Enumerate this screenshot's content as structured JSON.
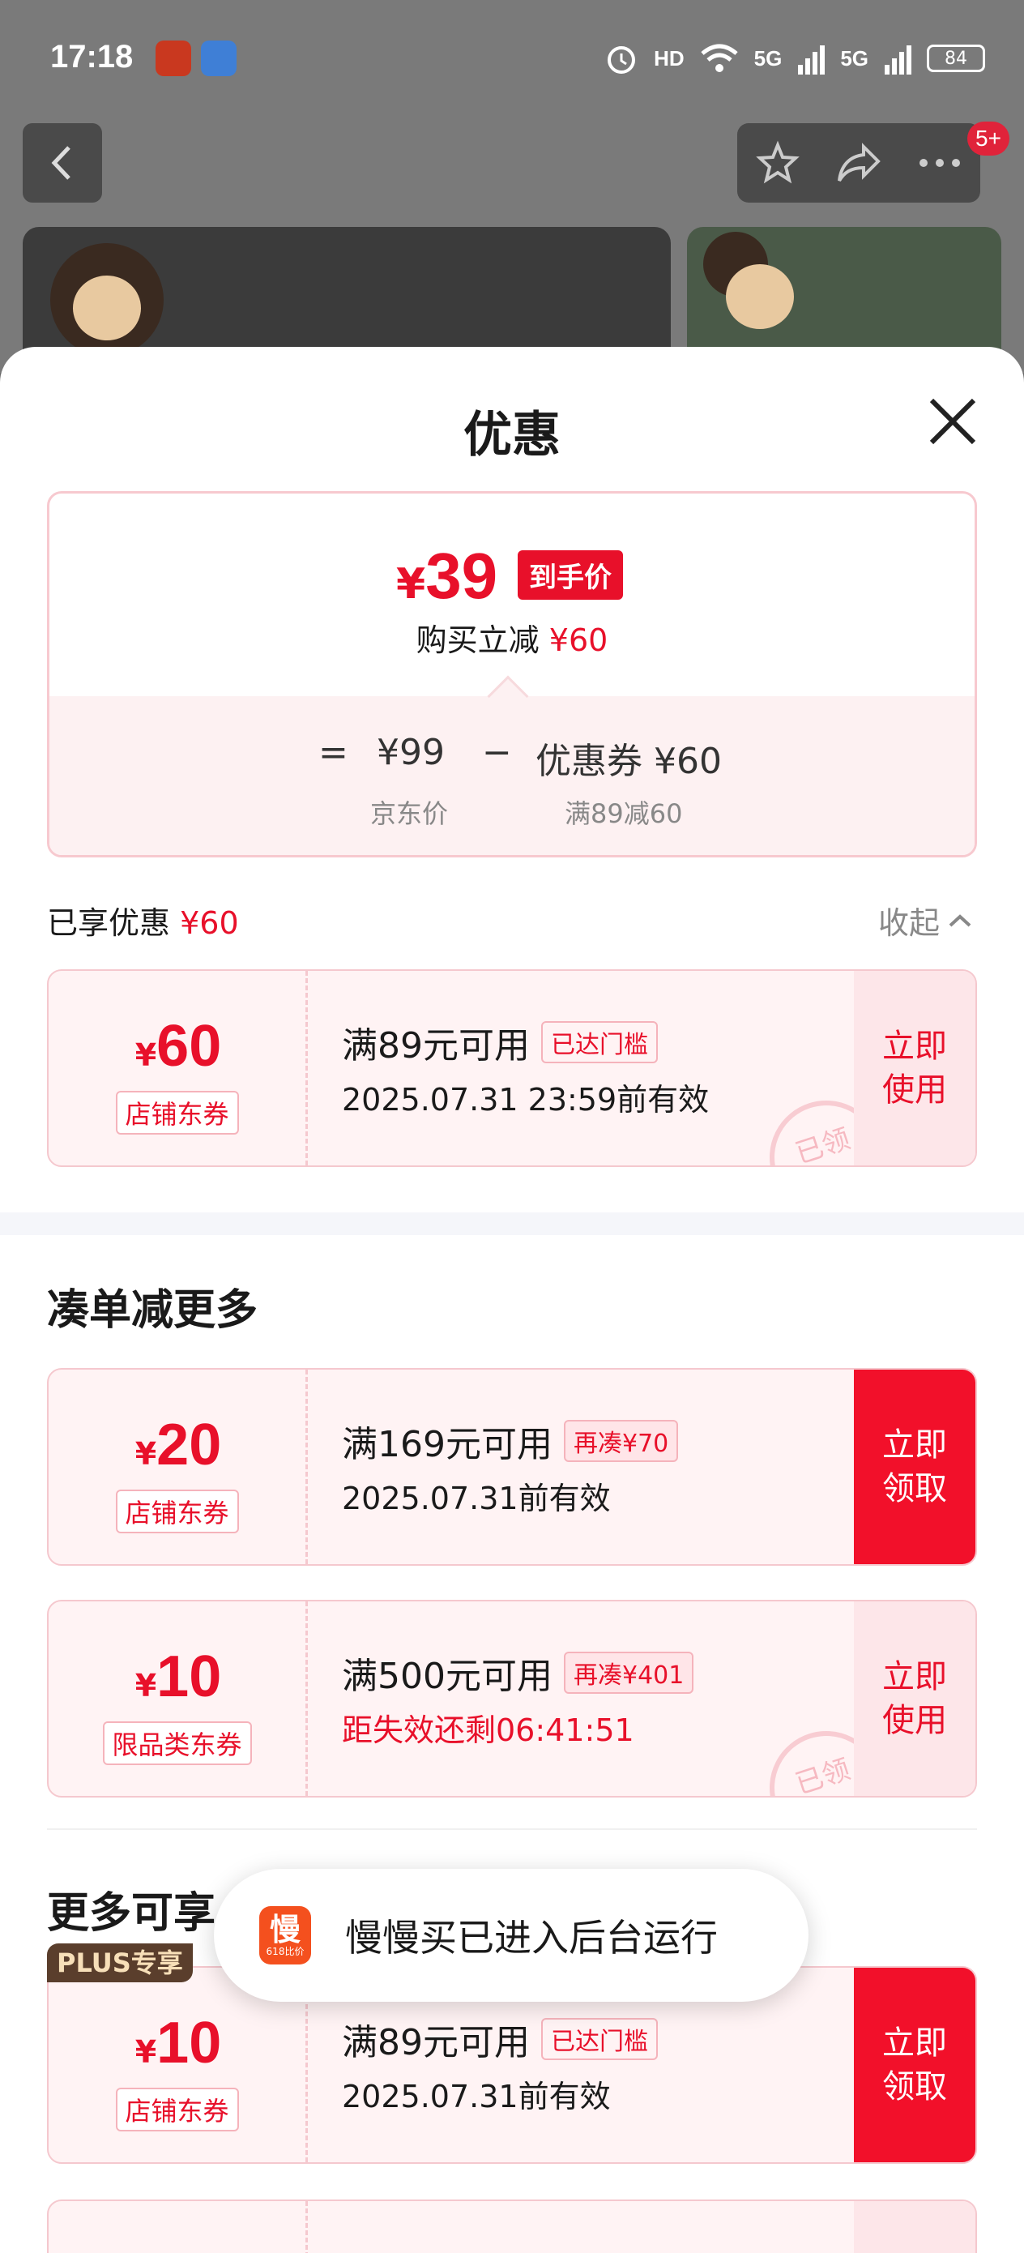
{
  "status_bar": {
    "time": "17:18",
    "hd_label": "HD",
    "net1": "5G",
    "net2": "5G",
    "battery": "84"
  },
  "header": {
    "badge_count": "5+",
    "icons": [
      "back-arrow-icon",
      "star-icon",
      "share-icon",
      "more-icon"
    ]
  },
  "sheet": {
    "title": "优惠",
    "summary": {
      "currency": "¥",
      "final_price": "39",
      "price_tag": "到手价",
      "direct_cut_label": "购买立减",
      "direct_cut_value": "¥60",
      "eq": "=",
      "jd_price": "¥99",
      "minus": "−",
      "coupon_label": "优惠券 ¥60",
      "jd_price_caption": "京东价",
      "coupon_caption": "满89减60"
    },
    "enjoyed": {
      "label": "已享优惠",
      "value": "¥60",
      "collapse": "收起"
    },
    "enjoyed_coupon": {
      "currency": "¥",
      "amount": "60",
      "type": "店铺东券",
      "condition": "满89元可用",
      "tag": "已达门槛",
      "validity": "2025.07.31 23:59前有效",
      "button": "立即\n使用",
      "stamp": "已领"
    },
    "more_section_title": "凑单减更多",
    "more_coupons": [
      {
        "currency": "¥",
        "amount": "20",
        "type": "店铺东券",
        "condition": "满169元可用",
        "tag": "再凑¥70",
        "validity": "2025.07.31前有效",
        "button": "立即\n领取"
      },
      {
        "badge": "PLUS专享",
        "currency": "¥",
        "amount": "10",
        "type": "限品类东券",
        "condition": "满500元可用",
        "tag": "再凑¥401",
        "validity": "距失效还剩06:41:51",
        "button": "立即\n使用",
        "stamp": "已领"
      }
    ],
    "available_section_title": "更多可享",
    "available_coupons": [
      {
        "currency": "¥",
        "amount": "10",
        "type": "店铺东券",
        "condition": "满89元可用",
        "tag": "已达门槛",
        "validity": "2025.07.31前有效",
        "button": "立即\n领取"
      }
    ]
  },
  "toast": {
    "icon_glyph": "慢",
    "icon_sub": "618比价",
    "text": "慢慢买已进入后台运行"
  },
  "colors": {
    "accent_red": "#e8102a",
    "coupon_bg": "#fff3f4",
    "plus_brown": "#5a3e2c"
  }
}
